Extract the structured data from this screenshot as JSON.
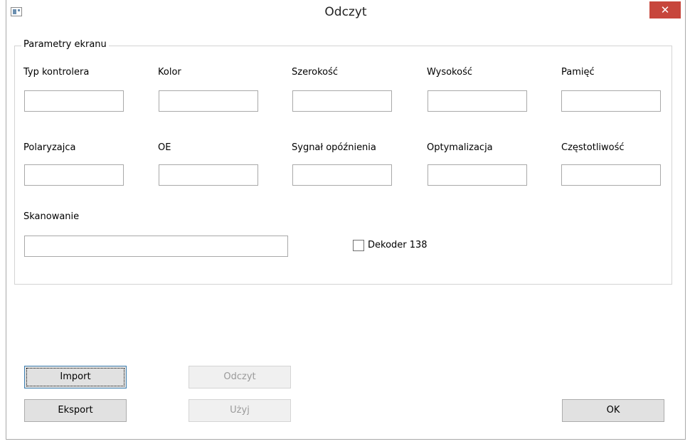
{
  "window": {
    "title": "Odczyt",
    "close_symbol": "✕"
  },
  "group": {
    "title": "Parametry ekranu"
  },
  "fields": {
    "typ_kontrolera": {
      "label": "Typ kontrolera",
      "value": ""
    },
    "kolor": {
      "label": "Kolor",
      "value": ""
    },
    "szerokosc": {
      "label": "Szerokość",
      "value": ""
    },
    "wysokosc": {
      "label": "Wysokość",
      "value": ""
    },
    "pamiec": {
      "label": "Pamięć",
      "value": ""
    },
    "polaryzajca": {
      "label": "Polaryzajca",
      "value": ""
    },
    "oe": {
      "label": "OE",
      "value": ""
    },
    "sygnal": {
      "label": "Sygnał opóźnienia",
      "value": ""
    },
    "optymalizacja": {
      "label": "Optymalizacja",
      "value": ""
    },
    "czestotliwosc": {
      "label": "Częstotliwość",
      "value": ""
    },
    "skanowanie": {
      "label": "Skanowanie",
      "value": ""
    }
  },
  "checkbox": {
    "label": "Dekoder 138",
    "checked": false
  },
  "buttons": {
    "import": "Import",
    "eksport": "Eksport",
    "odczyt": "Odczyt",
    "uzyj": "Użyj",
    "ok": "OK"
  }
}
